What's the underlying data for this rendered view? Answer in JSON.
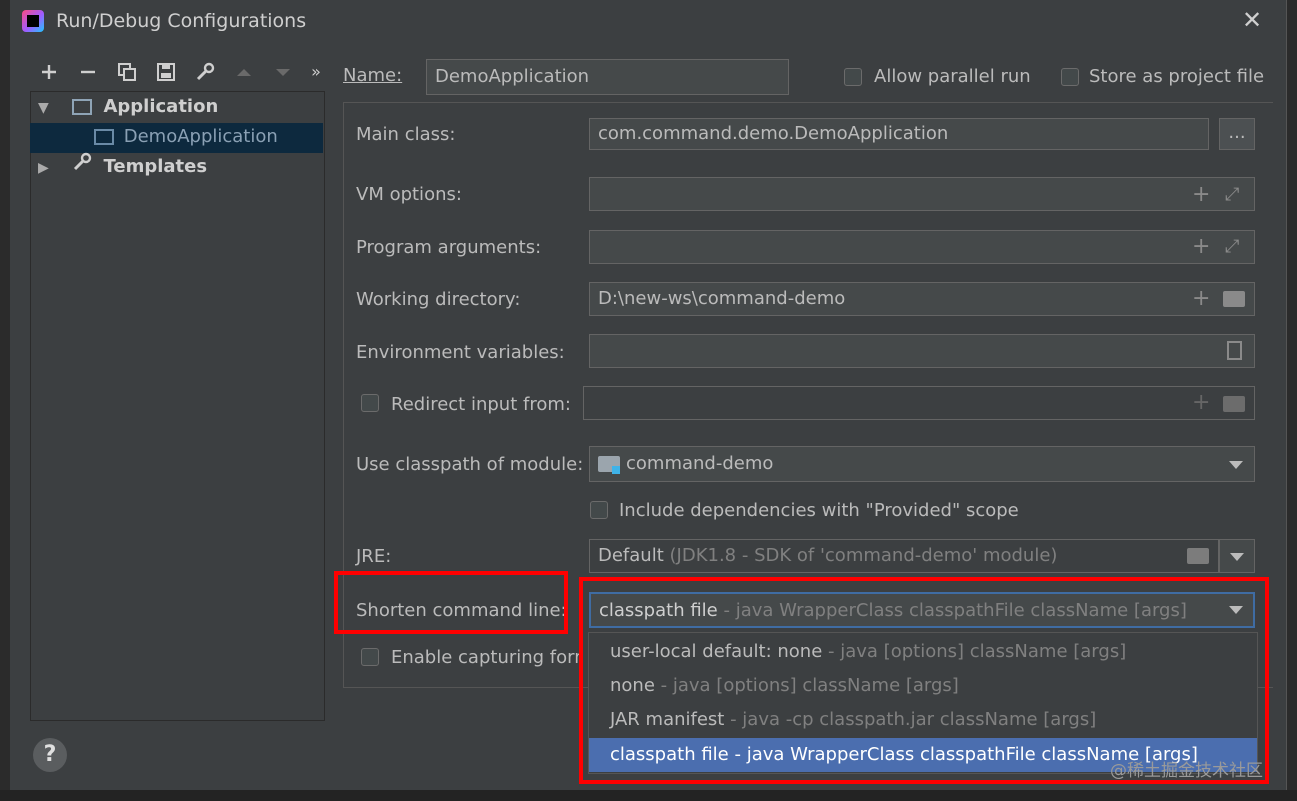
{
  "window": {
    "title": "Run/Debug Configurations"
  },
  "tree": {
    "application_label": "Application",
    "config_label": "DemoApplication",
    "templates_label": "Templates"
  },
  "form": {
    "name_label": "Name:",
    "name_value": "DemoApplication",
    "allow_parallel_label": "Allow parallel run",
    "store_project_label": "Store as project file",
    "main_class_label": "Main class:",
    "main_class_value": "com.command.demo.DemoApplication",
    "browse_label": "...",
    "vm_options_label": "VM options:",
    "program_args_label": "Program arguments:",
    "working_dir_label": "Working directory:",
    "working_dir_value": "D:\\new-ws\\command-demo",
    "env_vars_label": "Environment variables:",
    "redirect_label": "Redirect input from:",
    "classpath_module_label": "Use classpath of module:",
    "classpath_module_value": "command-demo",
    "include_deps_label": "Include dependencies with \"Provided\" scope",
    "jre_label": "JRE:",
    "jre_value": "Default",
    "jre_detail": "(JDK1.8 - SDK of 'command-demo' module)",
    "shorten_label": "Shorten command line:",
    "shorten_value": "classpath file",
    "shorten_detail": "- java WrapperClass classpathFile className [args]",
    "enable_capturing_label": "Enable capturing form"
  },
  "dropdown": {
    "options": [
      {
        "name": "user-local default: none",
        "detail": "- java [options] className [args]"
      },
      {
        "name": "none",
        "detail": "- java [options] className [args]"
      },
      {
        "name": "JAR manifest",
        "detail": "- java -cp classpath.jar className [args]"
      },
      {
        "name": "classpath file",
        "detail": "- java WrapperClass classpathFile className [args]"
      }
    ]
  },
  "watermark": "@稀土掘金技术社区",
  "help_label": "?",
  "colors": {
    "selection": "#4b6eaf",
    "highlight_box": "#ff0000",
    "background": "#3c3f41"
  }
}
